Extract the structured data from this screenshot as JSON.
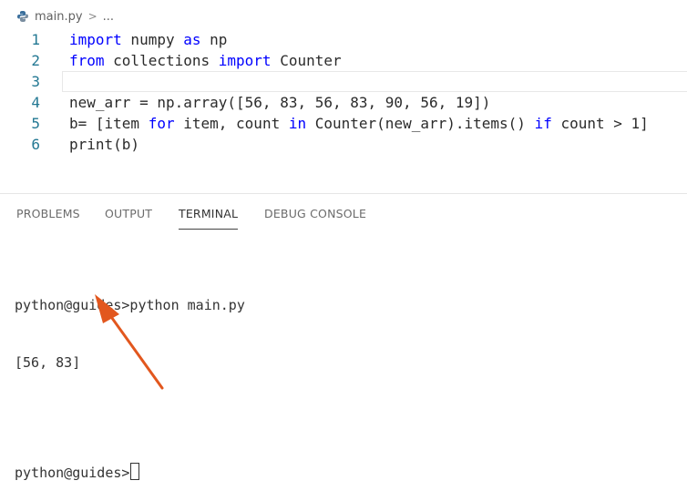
{
  "breadcrumb": {
    "file": "main.py",
    "separator": ">",
    "rest": "..."
  },
  "editor": {
    "lines": [
      {
        "num": "1",
        "tokens": [
          {
            "t": "import",
            "kw": true
          },
          {
            "t": " numpy "
          },
          {
            "t": "as",
            "kw": true
          },
          {
            "t": " np"
          }
        ]
      },
      {
        "num": "2",
        "tokens": [
          {
            "t": "from",
            "kw": true
          },
          {
            "t": " collections "
          },
          {
            "t": "import",
            "kw": true
          },
          {
            "t": " Counter"
          }
        ]
      },
      {
        "num": "3",
        "tokens": []
      },
      {
        "num": "4",
        "tokens": [
          {
            "t": "new_arr = np.array([56, 83, 56, 83, 90, 56, 19])"
          }
        ]
      },
      {
        "num": "5",
        "tokens": [
          {
            "t": "b= [item "
          },
          {
            "t": "for",
            "kw": true
          },
          {
            "t": " item, count "
          },
          {
            "t": "in",
            "kw": true
          },
          {
            "t": " Counter(new_arr).items() "
          },
          {
            "t": "if",
            "kw": true
          },
          {
            "t": " count > 1]"
          }
        ]
      },
      {
        "num": "6",
        "tokens": [
          {
            "t": "print(b)"
          }
        ]
      }
    ]
  },
  "panel": {
    "tabs": [
      "PROBLEMS",
      "OUTPUT",
      "TERMINAL",
      "DEBUG CONSOLE"
    ],
    "active_tab": "TERMINAL"
  },
  "terminal": {
    "command_line": "python@guides>python main.py",
    "output_line": "[56, 83]",
    "prompt": "python@guides>"
  },
  "colors": {
    "keyword": "#0000ff",
    "line_number": "#237893",
    "arrow": "#e2571e"
  }
}
